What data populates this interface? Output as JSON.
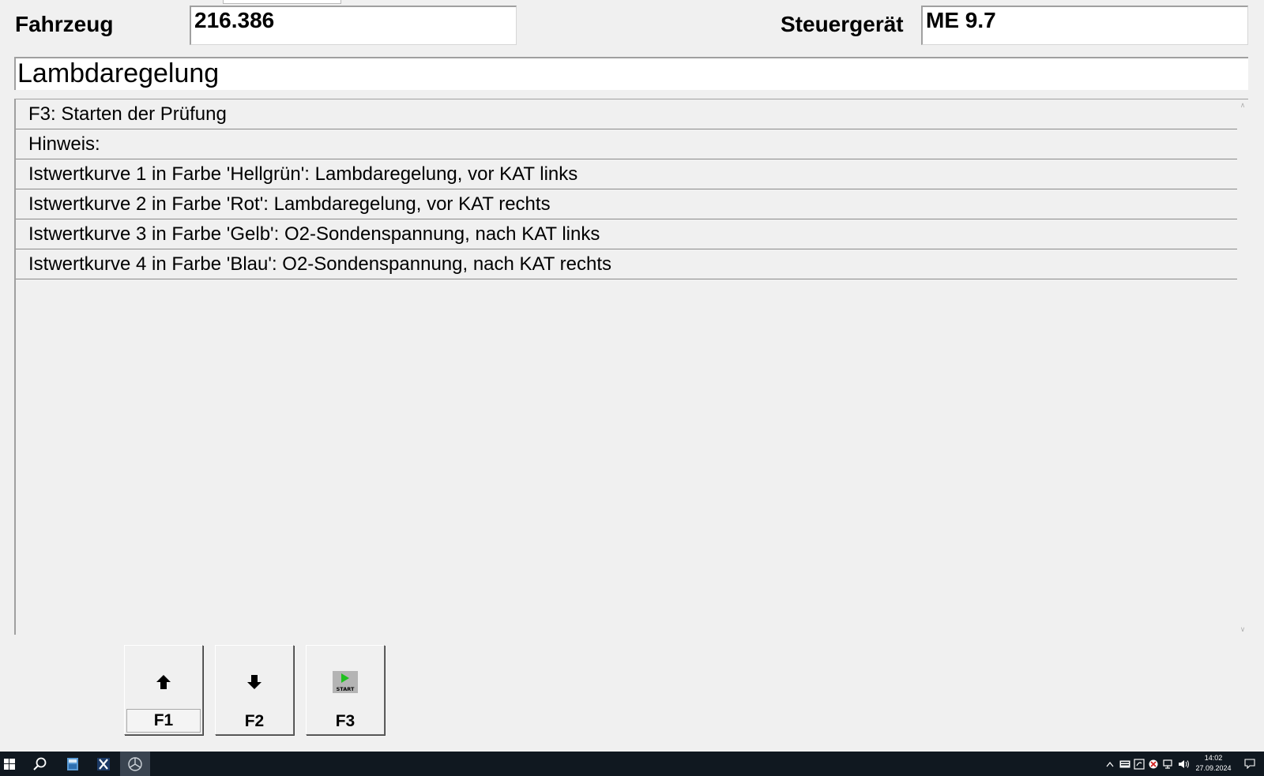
{
  "header": {
    "vehicle_label": "Fahrzeug",
    "vehicle_value": "216.386",
    "ecu_label": "Steuergerät",
    "ecu_value": "ME 9.7"
  },
  "test": {
    "title": "Lambdaregelung",
    "lines": [
      "F3: Starten der Prüfung",
      "Hinweis:",
      "Istwertkurve 1 in Farbe 'Hellgrün': Lambdaregelung, vor KAT links",
      "Istwertkurve 2 in Farbe 'Rot': Lambdaregelung, vor KAT rechts",
      "Istwertkurve 3 in Farbe 'Gelb': O2-Sondenspannung, nach KAT links",
      "Istwertkurve 4 in Farbe 'Blau': O2-Sondenspannung, nach KAT rechts"
    ]
  },
  "function_keys": [
    {
      "label": "F1",
      "icon": "arrow-up-icon"
    },
    {
      "label": "F2",
      "icon": "arrow-down-icon"
    },
    {
      "label": "F3",
      "icon": "start-icon",
      "icon_text": "START"
    }
  ],
  "taskbar": {
    "time": "14:02",
    "date": "27.09.2024",
    "icons": [
      "windows-start-icon",
      "search-icon",
      "file-explorer-icon",
      "xentry-icon",
      "mercedes-star-icon"
    ]
  },
  "colors": {
    "background": "#f0f0f0",
    "taskbar": "#101820",
    "start_green": "#20c020"
  }
}
